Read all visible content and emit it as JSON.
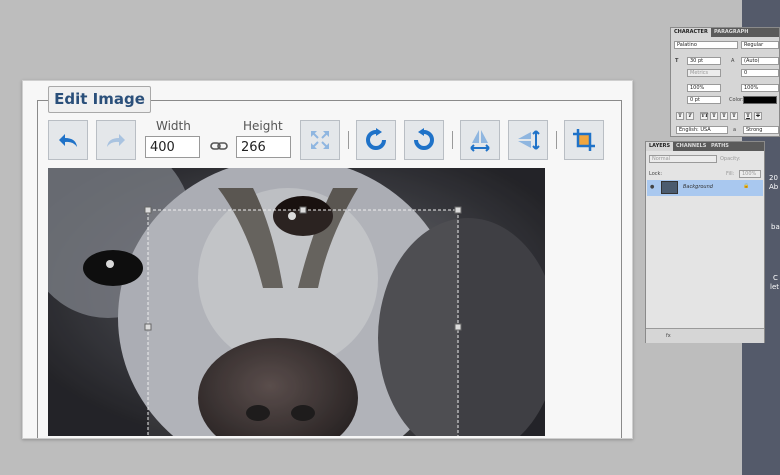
{
  "edit_image": {
    "title": "Edit Image",
    "width_label": "Width",
    "width_value": "400",
    "height_label": "Height",
    "height_value": "266"
  },
  "toolbar_icons": [
    "undo-icon",
    "redo-icon",
    "link-icon",
    "fit-to-screen-icon",
    "rotate-clockwise-icon",
    "rotate-counterclockwise-icon",
    "flip-horizontal-icon",
    "flip-vertical-icon",
    "crop-icon"
  ],
  "character_panel": {
    "tabs": [
      "CHARACTER",
      "PARAGRAPH"
    ],
    "font_family": "Palatino",
    "font_style": "Regular",
    "font_size": "30 pt",
    "leading": "(Auto)",
    "kerning": "Metrics",
    "tracking": "0",
    "vertical_scale": "100%",
    "horizontal_scale": "100%",
    "baseline_shift": "0 pt",
    "color_label": "Color:",
    "language": "English: USA",
    "aa_label": "a",
    "antialias": "Strong"
  },
  "layers_panel": {
    "tabs": [
      "LAYERS",
      "CHANNELS",
      "PATHS"
    ],
    "blend_mode": "Normal",
    "opacity_label": "Opacity:",
    "lock_label": "Lock:",
    "fill_label": "Fill:",
    "fill_value": "100%",
    "layer_name": "Background",
    "footer_text": "fx"
  },
  "right_strip_texts": [
    "20",
    "Ab",
    "ba",
    "C",
    "let"
  ],
  "colors": {
    "background": "#bdbdbd",
    "title_text": "#2a4f7a",
    "icon_blue": "#1f72c8",
    "layer_selected": "#a9c8ef"
  }
}
